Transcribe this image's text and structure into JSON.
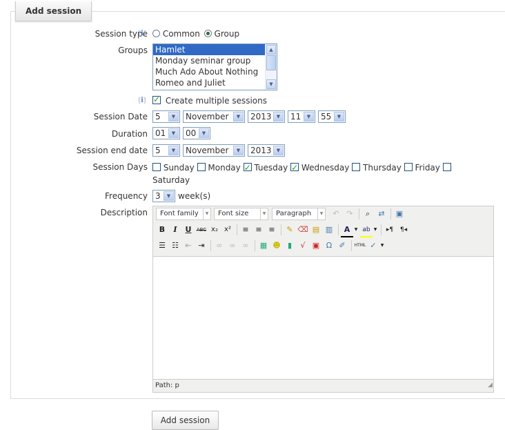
{
  "legend": "Add session",
  "session_type": {
    "label": "Session type",
    "options": [
      "Common",
      "Group"
    ],
    "selected": "Group"
  },
  "groups": {
    "label": "Groups",
    "options": [
      "Hamlet",
      "Monday seminar group",
      "Much Ado About Nothing",
      "Romeo and Juliet"
    ],
    "selected": "Hamlet"
  },
  "multiple": {
    "label": "Create multiple sessions",
    "checked": true
  },
  "session_date": {
    "label": "Session Date",
    "day": "5",
    "month": "November",
    "year": "2013",
    "hour": "11",
    "minute": "55"
  },
  "duration": {
    "label": "Duration",
    "hours": "01",
    "minutes": "00"
  },
  "end_date": {
    "label": "Session end date",
    "day": "5",
    "month": "November",
    "year": "2013"
  },
  "session_days": {
    "label": "Session Days",
    "days": [
      {
        "name": "Sunday",
        "checked": false
      },
      {
        "name": "Monday",
        "checked": false
      },
      {
        "name": "Tuesday",
        "checked": true
      },
      {
        "name": "Wednesday",
        "checked": true
      },
      {
        "name": "Thursday",
        "checked": false
      },
      {
        "name": "Friday",
        "checked": false
      },
      {
        "name": "Saturday",
        "checked": false
      }
    ]
  },
  "frequency": {
    "label": "Frequency",
    "value": "3",
    "unit": "week(s)"
  },
  "description": {
    "label": "Description",
    "font_family": "Font family",
    "font_size": "Font size",
    "format": "Paragraph",
    "path": "Path: p"
  },
  "submit_label": "Add session"
}
